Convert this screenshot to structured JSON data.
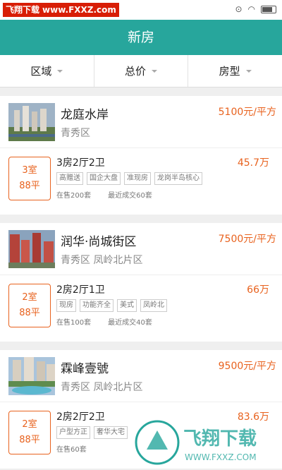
{
  "statusbar": {
    "watermark_cn": "飞翔下载",
    "watermark_site": "www.FXXZ.com",
    "time": ""
  },
  "header": {
    "title": "新房"
  },
  "filters": [
    {
      "label": "区域"
    },
    {
      "label": "总价"
    },
    {
      "label": "房型"
    }
  ],
  "listings": [
    {
      "name": "龙庭水岸",
      "price": "5100元/平方",
      "area": "青秀区",
      "rooms": "3室",
      "size": "88平",
      "layout": "3房2厅2卫",
      "total": "45.7万",
      "tags": [
        "高赠送",
        "国企大盘",
        "准现房",
        "龙岗半岛核心"
      ],
      "on_sale": "在售200套",
      "recent": "最近成交60套"
    },
    {
      "name": "润华·尚城街区",
      "price": "7500元/平方",
      "area": "青秀区 凤岭北片区",
      "rooms": "2室",
      "size": "88平",
      "layout": "2房2厅1卫",
      "total": "66万",
      "tags": [
        "现房",
        "功能齐全",
        "美式",
        "凤岭北"
      ],
      "on_sale": "在售100套",
      "recent": "最近成交40套"
    },
    {
      "name": "霖峰壹號",
      "price": "9500元/平方",
      "area": "青秀区 凤岭北片区",
      "rooms": "2室",
      "size": "88平",
      "layout": "2房2厅2卫",
      "total": "83.6万",
      "tags": [
        "户型方正",
        "奢华大宅"
      ],
      "on_sale": "在售60套",
      "recent": ""
    }
  ],
  "brand_watermark": {
    "cn": "飞翔下载",
    "site": "WWW.FXXZ.COM"
  },
  "colors": {
    "primary": "#27a69c",
    "accent": "#e8621e"
  }
}
